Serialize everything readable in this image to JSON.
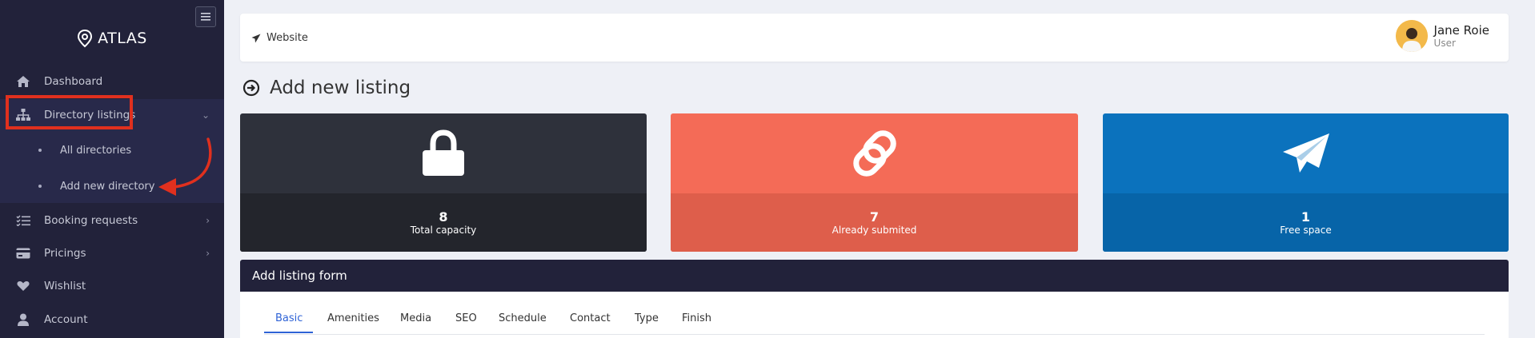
{
  "sidebar": {
    "brand": "ATLAS",
    "items": [
      {
        "label": "Dashboard",
        "icon": "home-icon"
      },
      {
        "label": "Directory listings",
        "icon": "sitemap-icon"
      },
      {
        "label": "Booking requests",
        "icon": "list-check-icon"
      },
      {
        "label": "Pricings",
        "icon": "credit-card-icon"
      },
      {
        "label": "Wishlist",
        "icon": "heart-icon"
      },
      {
        "label": "Account",
        "icon": "user-icon"
      }
    ],
    "subitems": [
      {
        "label": "All directories"
      },
      {
        "label": "Add new directory"
      }
    ]
  },
  "header": {
    "website_label": "Website",
    "user_name": "Jane Roie",
    "user_role": "User"
  },
  "page": {
    "title": "Add new listing"
  },
  "stats": [
    {
      "value": "8",
      "caption": "Total capacity",
      "icon": "lock-icon",
      "color": "#2e313b"
    },
    {
      "value": "7",
      "caption": "Already submited",
      "icon": "link-icon",
      "color": "#f46b57"
    },
    {
      "value": "1",
      "caption": "Free space",
      "icon": "paper-plane-icon",
      "color": "#0b72bd"
    }
  ],
  "form": {
    "title": "Add listing form",
    "tabs": [
      {
        "label": "Basic"
      },
      {
        "label": "Amenities"
      },
      {
        "label": "Media"
      },
      {
        "label": "SEO"
      },
      {
        "label": "Schedule"
      },
      {
        "label": "Contact"
      },
      {
        "label": "Type"
      },
      {
        "label": "Finish"
      }
    ]
  },
  "colors": {
    "sidebar_bg": "#22223a",
    "accent": "#2f63d6",
    "annotation": "#e0301e"
  }
}
